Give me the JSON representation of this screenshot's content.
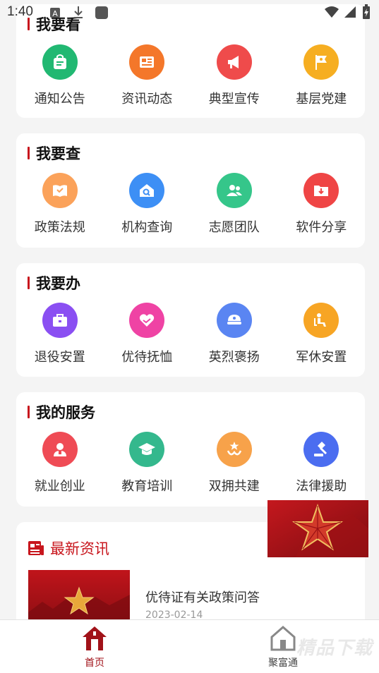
{
  "status_bar": {
    "time": "1:40"
  },
  "sections": [
    {
      "title": "我要看",
      "items": [
        {
          "label": "通知公告",
          "color": "#21b872",
          "icon": "bag-icon"
        },
        {
          "label": "资讯动态",
          "color": "#f4772a",
          "icon": "newspaper-icon"
        },
        {
          "label": "典型宣传",
          "color": "#ef4b4b",
          "icon": "megaphone-icon"
        },
        {
          "label": "基层党建",
          "color": "#f6ae21",
          "icon": "flag-icon"
        }
      ]
    },
    {
      "title": "我要查",
      "items": [
        {
          "label": "政策法规",
          "color": "#fba25a",
          "icon": "book-icon"
        },
        {
          "label": "机构查询",
          "color": "#3d8ff5",
          "icon": "building-search-icon"
        },
        {
          "label": "志愿团队",
          "color": "#35c68a",
          "icon": "people-icon"
        },
        {
          "label": "软件分享",
          "color": "#ef4545",
          "icon": "download-folder-icon"
        }
      ]
    },
    {
      "title": "我要办",
      "items": [
        {
          "label": "退役安置",
          "color": "#8a4ff2",
          "icon": "briefcase-icon"
        },
        {
          "label": "优待抚恤",
          "color": "#ef43a4",
          "icon": "heart-hands-icon"
        },
        {
          "label": "英烈褒扬",
          "color": "#5a85f2",
          "icon": "military-cap-icon"
        },
        {
          "label": "军休安置",
          "color": "#f7a524",
          "icon": "armchair-icon"
        }
      ]
    },
    {
      "title": "我的服务",
      "items": [
        {
          "label": "就业创业",
          "color": "#ef4b55",
          "icon": "worker-icon"
        },
        {
          "label": "教育培训",
          "color": "#34b88d",
          "icon": "graduation-cap-icon"
        },
        {
          "label": "双拥共建",
          "color": "#f7a24a",
          "icon": "star-emblem-icon"
        },
        {
          "label": "法律援助",
          "color": "#4b6df0",
          "icon": "gavel-icon"
        }
      ]
    }
  ],
  "news": {
    "section_title": "最新资讯",
    "items": [
      {
        "title": "优待证有关政策问答",
        "date": "2023-02-14"
      }
    ]
  },
  "tabbar": {
    "tabs": [
      {
        "label": "首页",
        "active": true
      },
      {
        "label": "聚富通",
        "active": false
      }
    ]
  },
  "watermark": "精品下载",
  "colors": {
    "accent": "#c8161d",
    "card_bg": "#ffffff",
    "page_bg": "#f4f4f4"
  }
}
